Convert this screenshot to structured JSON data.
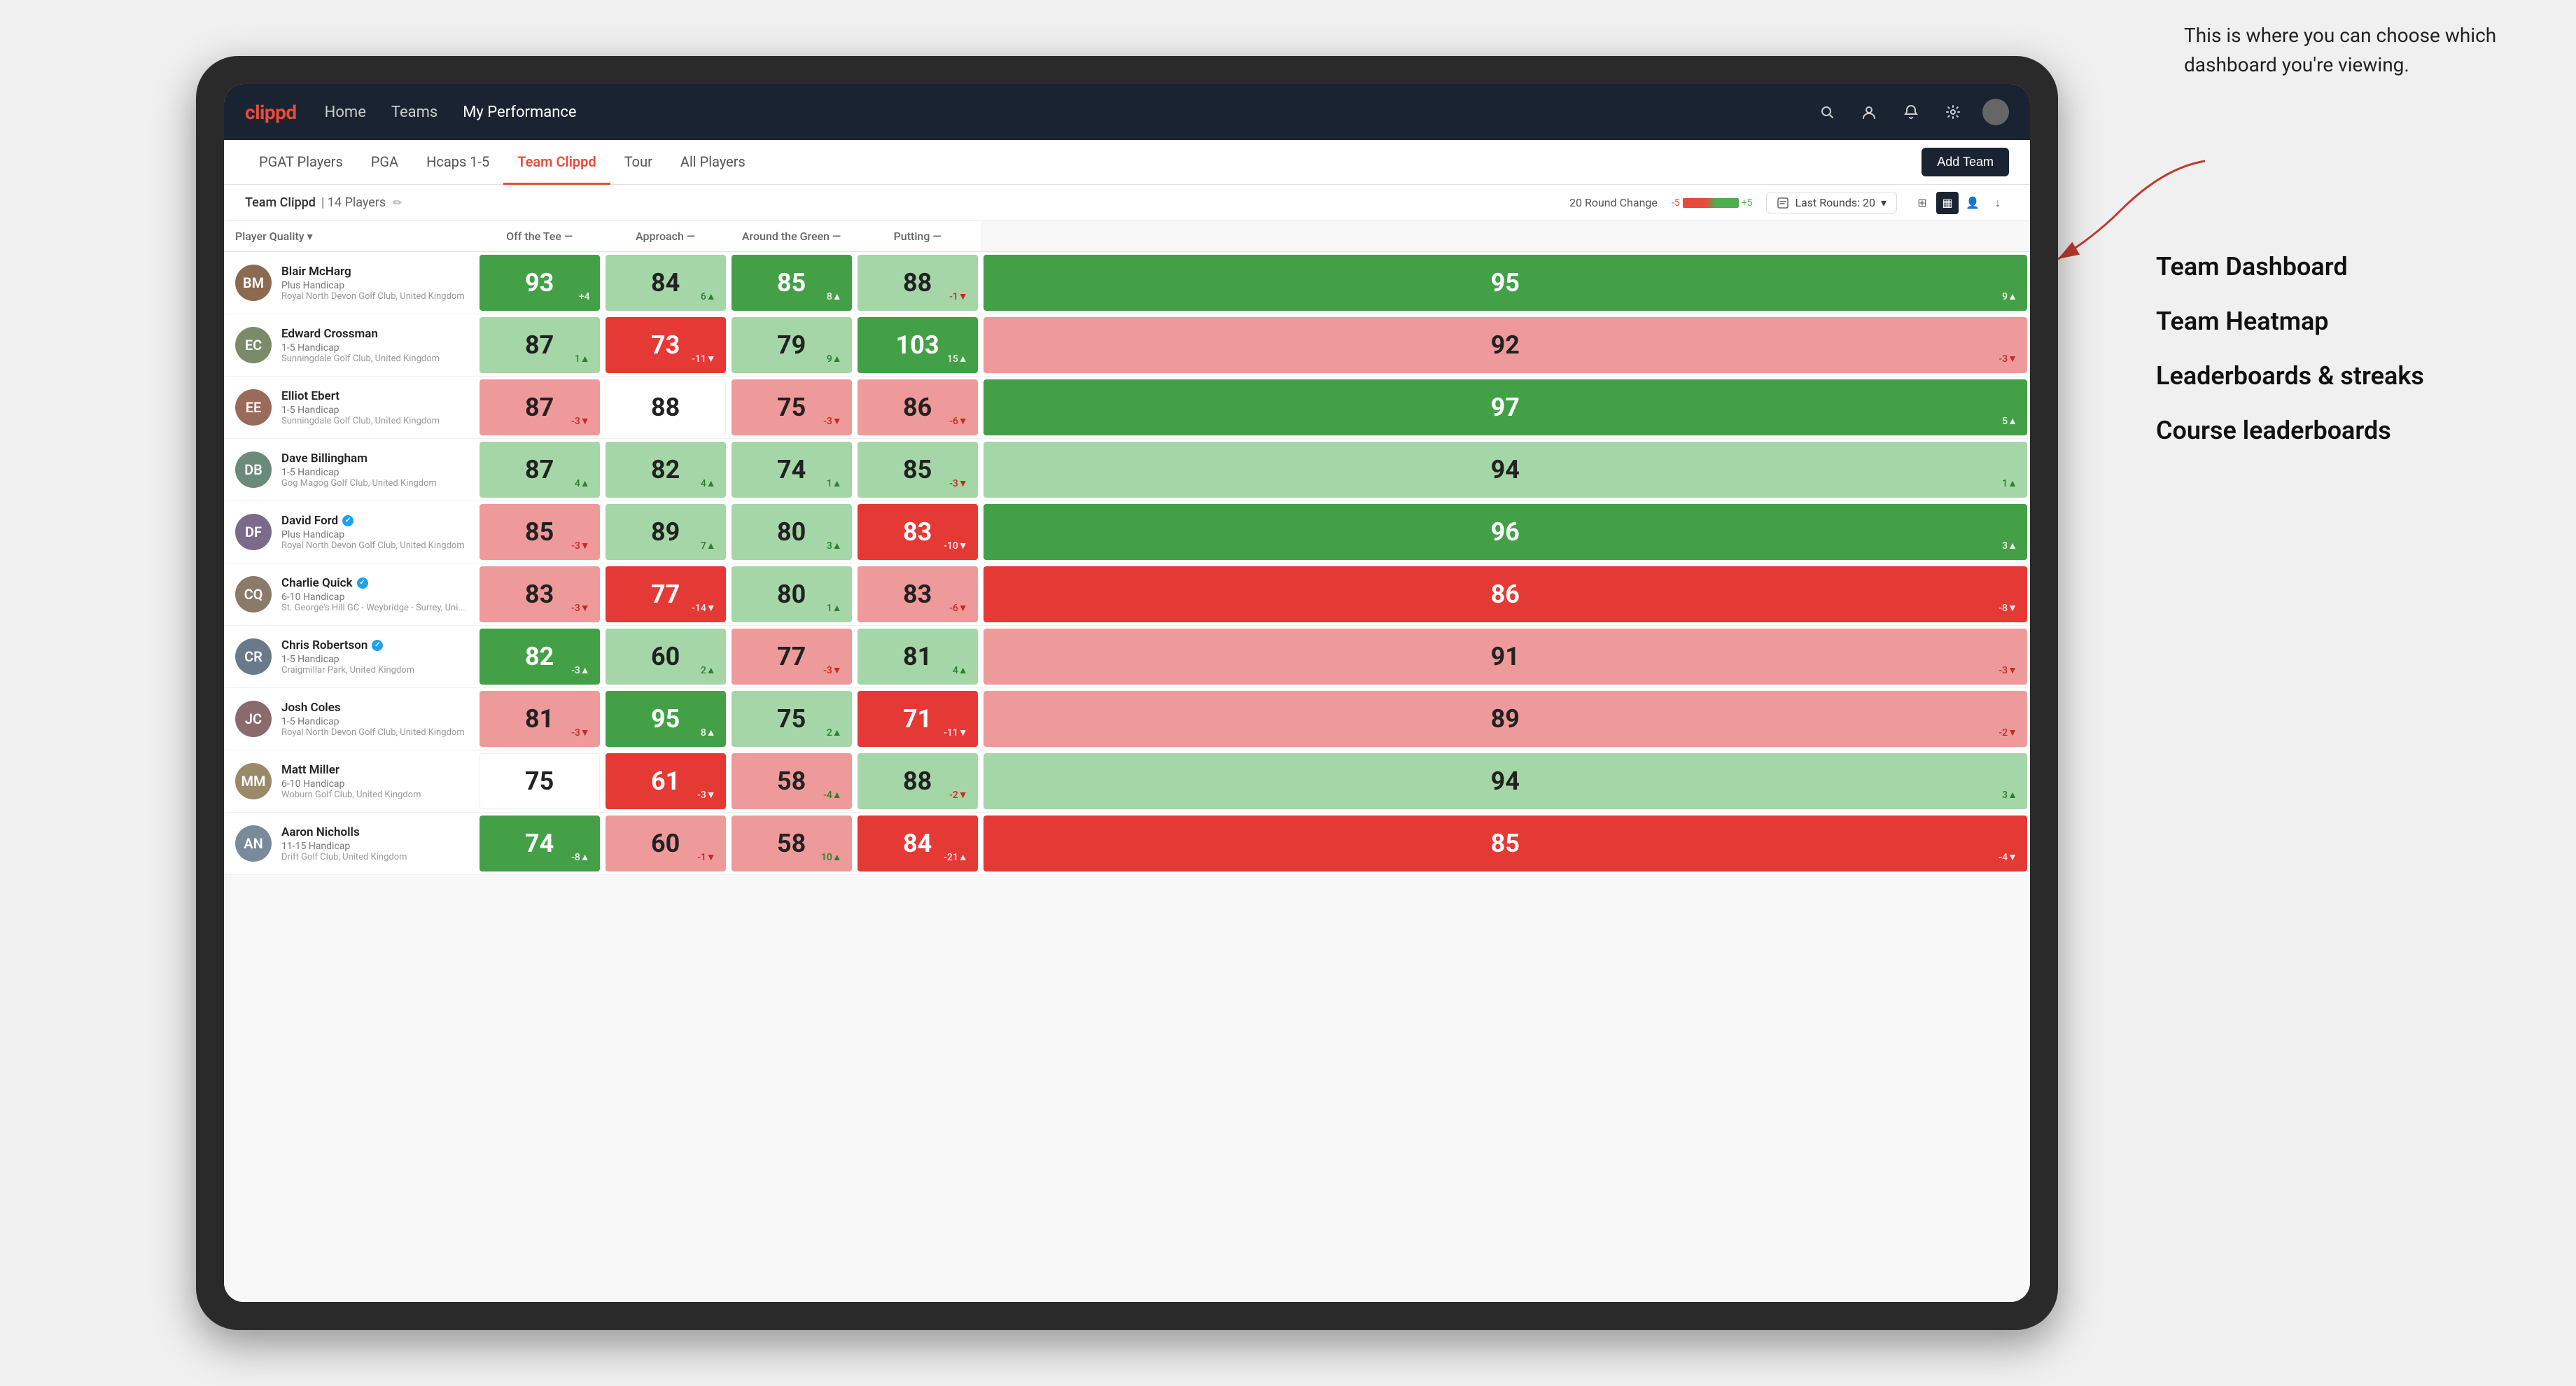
{
  "annotation": {
    "intro": "This is where you can choose which dashboard you're viewing.",
    "options": [
      "Team Dashboard",
      "Team Heatmap",
      "Leaderboards & streaks",
      "Course leaderboards"
    ]
  },
  "nav": {
    "logo": "clippd",
    "links": [
      "Home",
      "Teams",
      "My Performance"
    ],
    "active_link": "My Performance"
  },
  "tabs": {
    "items": [
      "PGAT Players",
      "PGA",
      "Hcaps 1-5",
      "Team Clippd",
      "Tour",
      "All Players"
    ],
    "active": "Team Clippd",
    "add_team_label": "Add Team"
  },
  "team_bar": {
    "name": "Team Clippd",
    "separator": "|",
    "count": "14 Players",
    "round_change_label": "20 Round Change",
    "change_neg": "-5",
    "change_pos": "+5",
    "last_rounds_label": "Last Rounds:",
    "last_rounds_value": "20"
  },
  "table": {
    "col_headers": [
      "Player Quality ▾",
      "Off the Tee —",
      "Approach —",
      "Around the Green —",
      "Putting —"
    ],
    "players": [
      {
        "name": "Blair McHarg",
        "handicap": "Plus Handicap",
        "club": "Royal North Devon Golf Club, United Kingdom",
        "initials": "BM",
        "avatar_color": "#8B6A50",
        "scores": [
          {
            "value": 93,
            "delta": "+4",
            "dir": "up",
            "bg": "bg-green"
          },
          {
            "value": 84,
            "delta": "6▲",
            "dir": "up",
            "bg": "bg-green-light"
          },
          {
            "value": 85,
            "delta": "8▲",
            "dir": "up",
            "bg": "bg-green"
          },
          {
            "value": 88,
            "delta": "-1▼",
            "dir": "down",
            "bg": "bg-green-light"
          },
          {
            "value": 95,
            "delta": "9▲",
            "dir": "up",
            "bg": "bg-green"
          }
        ]
      },
      {
        "name": "Edward Crossman",
        "handicap": "1-5 Handicap",
        "club": "Sunningdale Golf Club, United Kingdom",
        "initials": "EC",
        "avatar_color": "#7B8B6A",
        "scores": [
          {
            "value": 87,
            "delta": "1▲",
            "dir": "up",
            "bg": "bg-green-light"
          },
          {
            "value": 73,
            "delta": "-11▼",
            "dir": "down",
            "bg": "bg-red"
          },
          {
            "value": 79,
            "delta": "9▲",
            "dir": "up",
            "bg": "bg-green-light"
          },
          {
            "value": 103,
            "delta": "15▲",
            "dir": "up",
            "bg": "bg-green"
          },
          {
            "value": 92,
            "delta": "-3▼",
            "dir": "down",
            "bg": "bg-red-light"
          }
        ]
      },
      {
        "name": "Elliot Ebert",
        "handicap": "1-5 Handicap",
        "club": "Sunningdale Golf Club, United Kingdom",
        "initials": "EE",
        "avatar_color": "#9A6B5A",
        "scores": [
          {
            "value": 87,
            "delta": "-3▼",
            "dir": "down",
            "bg": "bg-red-light"
          },
          {
            "value": 88,
            "delta": "",
            "dir": "neutral",
            "bg": "bg-white"
          },
          {
            "value": 75,
            "delta": "-3▼",
            "dir": "down",
            "bg": "bg-red-light"
          },
          {
            "value": 86,
            "delta": "-6▼",
            "dir": "down",
            "bg": "bg-red-light"
          },
          {
            "value": 97,
            "delta": "5▲",
            "dir": "up",
            "bg": "bg-green"
          }
        ]
      },
      {
        "name": "Dave Billingham",
        "handicap": "1-5 Handicap",
        "club": "Gog Magog Golf Club, United Kingdom",
        "initials": "DB",
        "avatar_color": "#6A8A7A",
        "scores": [
          {
            "value": 87,
            "delta": "4▲",
            "dir": "up",
            "bg": "bg-green-light"
          },
          {
            "value": 82,
            "delta": "4▲",
            "dir": "up",
            "bg": "bg-green-light"
          },
          {
            "value": 74,
            "delta": "1▲",
            "dir": "up",
            "bg": "bg-green-light"
          },
          {
            "value": 85,
            "delta": "-3▼",
            "dir": "down",
            "bg": "bg-green-light"
          },
          {
            "value": 94,
            "delta": "1▲",
            "dir": "up",
            "bg": "bg-green-light"
          }
        ]
      },
      {
        "name": "David Ford",
        "handicap": "Plus Handicap",
        "club": "Royal North Devon Golf Club, United Kingdom",
        "initials": "DF",
        "verified": true,
        "avatar_color": "#7A6B8A",
        "scores": [
          {
            "value": 85,
            "delta": "-3▼",
            "dir": "down",
            "bg": "bg-red-light"
          },
          {
            "value": 89,
            "delta": "7▲",
            "dir": "up",
            "bg": "bg-green-light"
          },
          {
            "value": 80,
            "delta": "3▲",
            "dir": "up",
            "bg": "bg-green-light"
          },
          {
            "value": 83,
            "delta": "-10▼",
            "dir": "down",
            "bg": "bg-red"
          },
          {
            "value": 96,
            "delta": "3▲",
            "dir": "up",
            "bg": "bg-green"
          }
        ]
      },
      {
        "name": "Charlie Quick",
        "handicap": "6-10 Handicap",
        "club": "St. George's Hill GC - Weybridge - Surrey, Uni...",
        "initials": "CQ",
        "verified": true,
        "avatar_color": "#8A7A6A",
        "scores": [
          {
            "value": 83,
            "delta": "-3▼",
            "dir": "down",
            "bg": "bg-red-light"
          },
          {
            "value": 77,
            "delta": "-14▼",
            "dir": "down",
            "bg": "bg-red"
          },
          {
            "value": 80,
            "delta": "1▲",
            "dir": "up",
            "bg": "bg-green-light"
          },
          {
            "value": 83,
            "delta": "-6▼",
            "dir": "down",
            "bg": "bg-red-light"
          },
          {
            "value": 86,
            "delta": "-8▼",
            "dir": "down",
            "bg": "bg-red"
          }
        ]
      },
      {
        "name": "Chris Robertson",
        "handicap": "1-5 Handicap",
        "club": "Craigmillar Park, United Kingdom",
        "initials": "CR",
        "verified": true,
        "avatar_color": "#6A7A8A",
        "scores": [
          {
            "value": 82,
            "delta": "-3▲",
            "dir": "up",
            "bg": "bg-green"
          },
          {
            "value": 60,
            "delta": "2▲",
            "dir": "up",
            "bg": "bg-green-light"
          },
          {
            "value": 77,
            "delta": "-3▼",
            "dir": "down",
            "bg": "bg-red-light"
          },
          {
            "value": 81,
            "delta": "4▲",
            "dir": "up",
            "bg": "bg-green-light"
          },
          {
            "value": 91,
            "delta": "-3▼",
            "dir": "down",
            "bg": "bg-red-light"
          }
        ]
      },
      {
        "name": "Josh Coles",
        "handicap": "1-5 Handicap",
        "club": "Royal North Devon Golf Club, United Kingdom",
        "initials": "JC",
        "avatar_color": "#8A6A6A",
        "scores": [
          {
            "value": 81,
            "delta": "-3▼",
            "dir": "down",
            "bg": "bg-red-light"
          },
          {
            "value": 95,
            "delta": "8▲",
            "dir": "up",
            "bg": "bg-green"
          },
          {
            "value": 75,
            "delta": "2▲",
            "dir": "up",
            "bg": "bg-green-light"
          },
          {
            "value": 71,
            "delta": "-11▼",
            "dir": "down",
            "bg": "bg-red"
          },
          {
            "value": 89,
            "delta": "-2▼",
            "dir": "down",
            "bg": "bg-red-light"
          }
        ]
      },
      {
        "name": "Matt Miller",
        "handicap": "6-10 Handicap",
        "club": "Woburn Golf Club, United Kingdom",
        "initials": "MM",
        "avatar_color": "#9A8A6A",
        "scores": [
          {
            "value": 75,
            "delta": "",
            "dir": "neutral",
            "bg": "bg-white"
          },
          {
            "value": 61,
            "delta": "-3▼",
            "dir": "down",
            "bg": "bg-red"
          },
          {
            "value": 58,
            "delta": "-4▲",
            "dir": "up",
            "bg": "bg-red-light"
          },
          {
            "value": 88,
            "delta": "-2▼",
            "dir": "down",
            "bg": "bg-green-light"
          },
          {
            "value": 94,
            "delta": "3▲",
            "dir": "up",
            "bg": "bg-green-light"
          }
        ]
      },
      {
        "name": "Aaron Nicholls",
        "handicap": "11-15 Handicap",
        "club": "Drift Golf Club, United Kingdom",
        "initials": "AN",
        "avatar_color": "#7A8A9A",
        "scores": [
          {
            "value": 74,
            "delta": "-8▲",
            "dir": "up",
            "bg": "bg-green"
          },
          {
            "value": 60,
            "delta": "-1▼",
            "dir": "down",
            "bg": "bg-red-light"
          },
          {
            "value": 58,
            "delta": "10▲",
            "dir": "up",
            "bg": "bg-red-light"
          },
          {
            "value": 84,
            "delta": "-21▲",
            "dir": "up",
            "bg": "bg-red"
          },
          {
            "value": 85,
            "delta": "-4▼",
            "dir": "down",
            "bg": "bg-red"
          }
        ]
      }
    ]
  }
}
